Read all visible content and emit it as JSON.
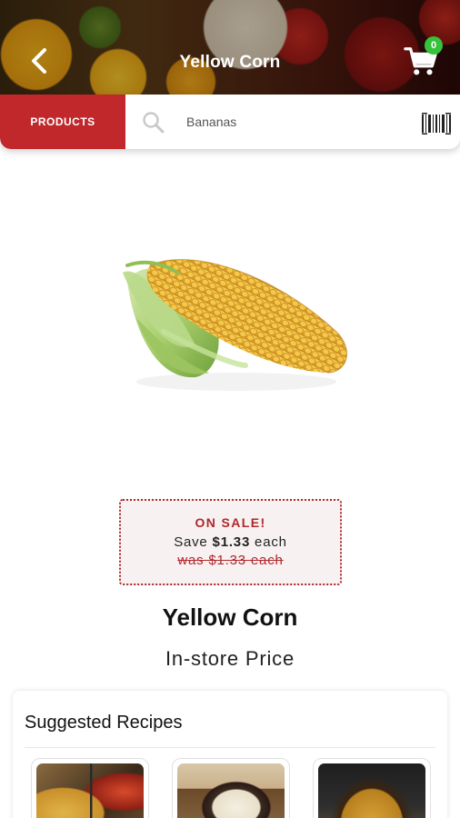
{
  "header": {
    "title": "Yellow Corn",
    "cart_count": "0"
  },
  "search": {
    "category_button": "PRODUCTS",
    "placeholder": "Bananas"
  },
  "product": {
    "name": "Yellow Corn",
    "price_label": "In-store Price",
    "sale": {
      "title": "ON SALE!",
      "save_prefix": "Save ",
      "save_amount": "$1.33",
      "save_suffix": " each",
      "was_text": "was $1.33 each"
    }
  },
  "recipes": {
    "title": "Suggested Recipes",
    "items": [
      {
        "icon": "recipe-photo-corn-casserole"
      },
      {
        "icon": "recipe-photo-dip-bowl"
      },
      {
        "icon": "recipe-photo-cornbread"
      }
    ]
  },
  "colors": {
    "brand_red": "#c0282b",
    "badge_green": "#36c23a",
    "sale_border": "#b0282b"
  }
}
